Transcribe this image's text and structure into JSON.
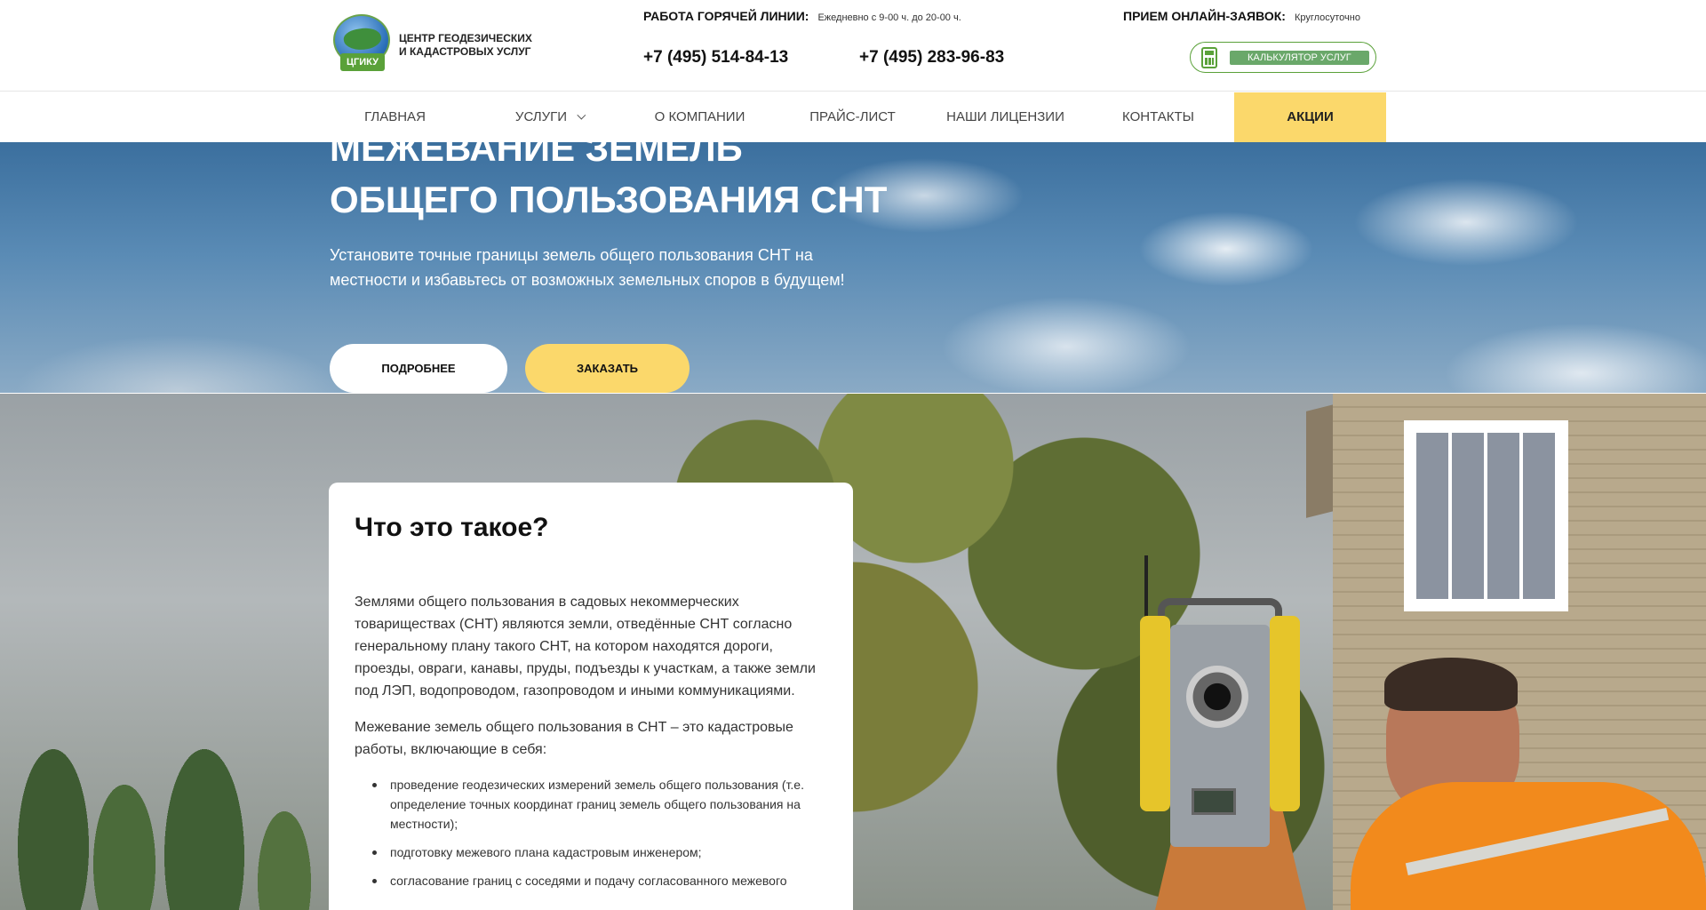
{
  "header": {
    "logo_badge": "ЦГИКУ",
    "logo_text": "ЦЕНТР ГЕОДЕЗИЧЕСКИХ И КАДАСТРОВЫХ УСЛУГ",
    "hotline_label": "РАБОТА ГОРЯЧЕЙ ЛИНИИ:",
    "hotline_hours": "Ежедневно с 9-00 ч. до 20-00 ч.",
    "phone1": "+7 (495) 514-84-13",
    "phone2": "+7 (495) 283-96-83",
    "online_label": "ПРИЕМ ОНЛАЙН-ЗАЯВОК:",
    "online_hours": "Круглосуточно",
    "calculator_label": "КАЛЬКУЛЯТОР УСЛУГ"
  },
  "nav": {
    "items": [
      {
        "label": "ГЛАВНАЯ"
      },
      {
        "label": "УСЛУГИ"
      },
      {
        "label": "О КОМПАНИИ"
      },
      {
        "label": "ПРАЙС-ЛИСТ"
      },
      {
        "label": "НАШИ ЛИЦЕНЗИИ"
      },
      {
        "label": "КОНТАКТЫ"
      },
      {
        "label": "АКЦИИ"
      }
    ]
  },
  "hero": {
    "title_line1": "МЕЖЕВАНИЕ ЗЕМЕЛЬ",
    "title_line2": "ОБЩЕГО ПОЛЬЗОВАНИЯ СНТ",
    "subtitle": "Установите точные границы земель общего пользования СНТ на местности и избавьтесь от возможных земельных споров в будущем!",
    "btn_more": "ПОДРОБНЕЕ",
    "btn_order": "ЗАКАЗАТЬ"
  },
  "info": {
    "title": "Что это такое?",
    "p1": "Землями общего пользования в садовых некоммерческих товариществах (СНТ) являются земли, отведённые СНТ согласно генеральному плану такого СНТ, на котором находятся дороги, проезды, овраги, канавы, пруды, подъезды к участкам, а также земли под ЛЭП, водопроводом, газопроводом и иными коммуникациями.",
    "p2": "Межевание земель общего пользования в СНТ – это кадастровые работы, включающие в себя:",
    "list": [
      "проведение геодезических измерений земель общего пользования (т.е. определение точных координат границ земель общего пользования на местности);",
      "подготовку межевого плана кадастровым инженером;",
      "согласование границ с соседями и подачу согласованного межевого"
    ]
  },
  "colors": {
    "accent_yellow": "#fbd86b",
    "brand_green": "#5aa139"
  }
}
